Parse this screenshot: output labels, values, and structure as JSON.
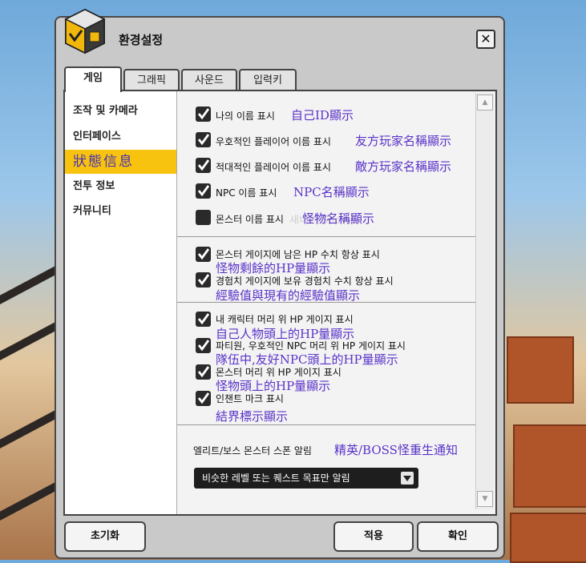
{
  "window": {
    "title": "환경설정",
    "close_symbol": "✕"
  },
  "tabs": [
    {
      "label": "게임",
      "active": true
    },
    {
      "label": "그래픽",
      "active": false
    },
    {
      "label": "사운드",
      "active": false
    },
    {
      "label": "입력키",
      "active": false
    }
  ],
  "sidebar": {
    "items": [
      {
        "label": "조작 및 카메라"
      },
      {
        "label": "인터페이스"
      },
      {
        "label": "狀態信息",
        "active": true
      },
      {
        "label": "전투 정보"
      },
      {
        "label": "커뮤니티"
      }
    ]
  },
  "name_options": [
    {
      "label": "나의 이름 표시",
      "translation": "自己ID顯示",
      "checked": true
    },
    {
      "label": "우호적인 플레이어 이름 표시",
      "translation": "友方玩家名稱顯示",
      "checked": true
    },
    {
      "label": "적대적인 플레이어 이름 표시",
      "translation": "敵方玩家名稱顯示",
      "checked": true
    },
    {
      "label": "NPC 이름 표시",
      "translation": "NPC名稱顯示",
      "checked": true
    },
    {
      "label": "몬스터 이름 표시",
      "translation": "怪物名稱顯示",
      "checked": false
    }
  ],
  "watermark": "새내기 Snow짓",
  "value_options": [
    {
      "label": "몬스터 게이지에 남은 HP 수치 항상 표시",
      "translation": "怪物剩餘的HP量顯示",
      "checked": true
    },
    {
      "label": "경험치 게이지에 보유 경험치 수치 항상 표시",
      "translation": "經驗值與現有的經驗值顯示",
      "checked": true
    }
  ],
  "gauge_options": [
    {
      "label": "내 캐릭터 머리 위 HP 게이지 표시",
      "translation": "自己人物頭上的HP量顯示",
      "checked": true
    },
    {
      "label": "파티원, 우호적인 NPC 머리 위 HP 게이지 표시",
      "translation": "隊伍中,友好NPC頭上的HP量顯示",
      "checked": true
    },
    {
      "label": "몬스터 머리 위 HP 게이지 표시",
      "translation": "怪物頭上的HP量顯示",
      "checked": true
    },
    {
      "label": "인챈트 마크 표시",
      "translation": "結界標示顯示",
      "checked": true
    }
  ],
  "spawn_alert": {
    "label": "엘리트/보스 몬스터 스폰 알림",
    "translation": "精英/BOSS怪重生通知",
    "selected": "비슷한 레벨 또는 퀘스트 목표만 알림"
  },
  "scrollbar": {
    "up": "▲",
    "down": "▼"
  },
  "buttons": {
    "reset": "초기화",
    "apply": "적용",
    "confirm": "확인"
  },
  "colors": {
    "accent": "#f7c30f",
    "translation_text": "#5a32c9"
  }
}
